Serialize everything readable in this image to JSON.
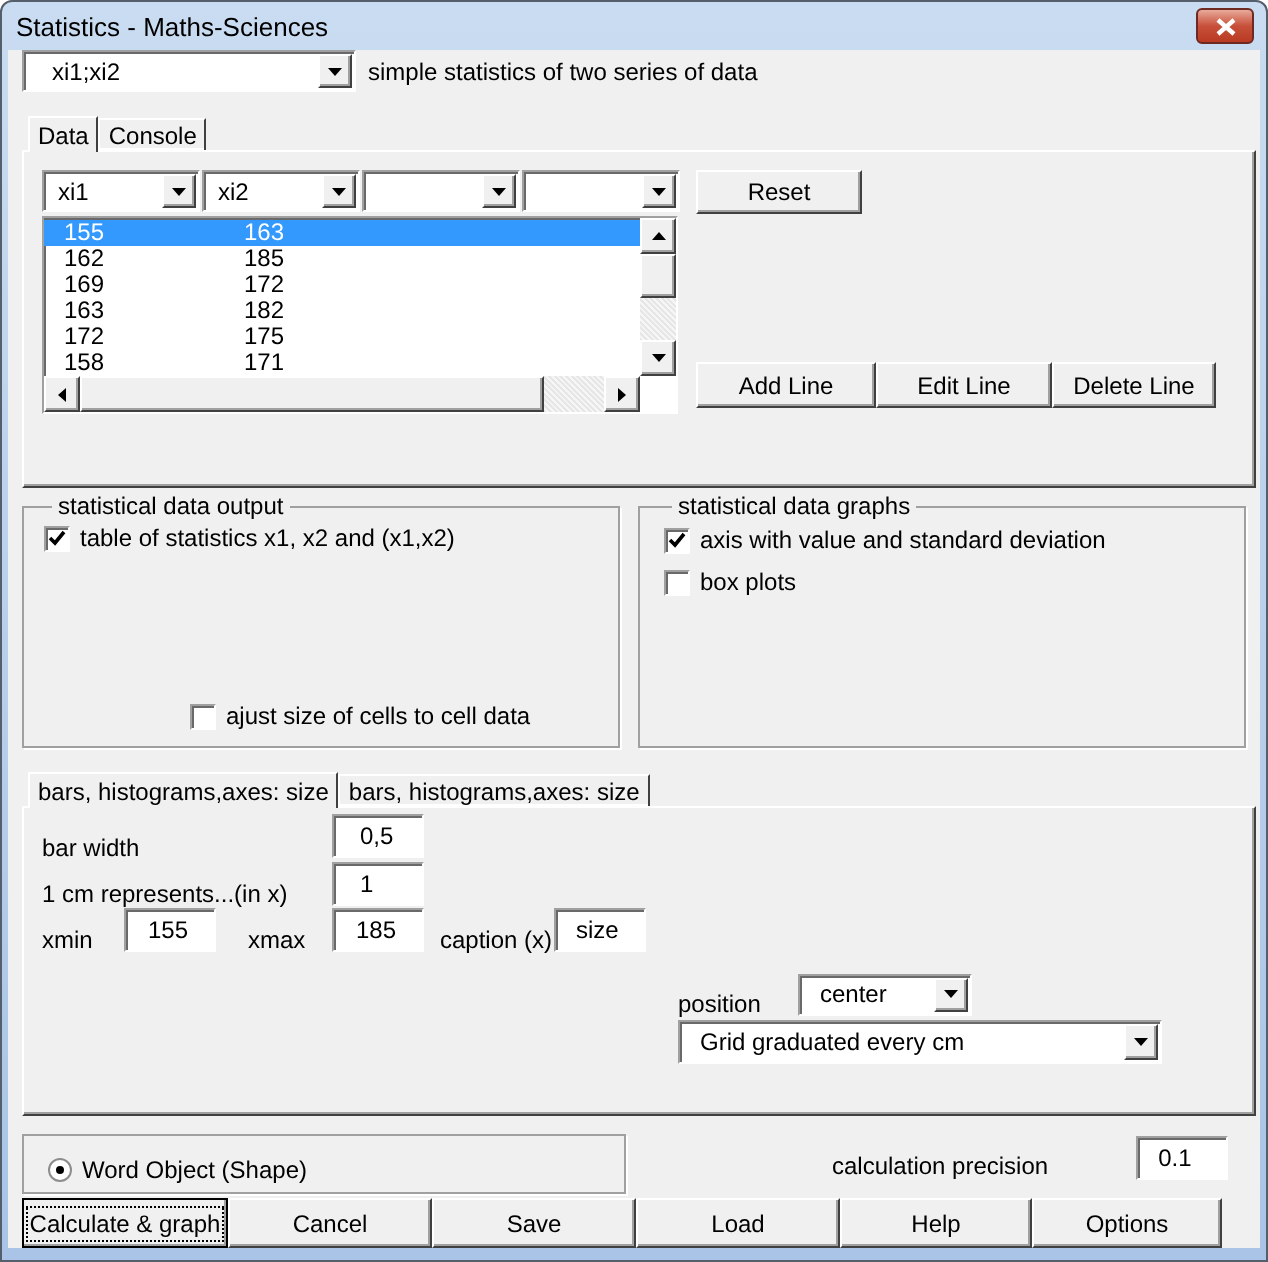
{
  "window": {
    "title": "Statistics - Maths-Sciences"
  },
  "series_select": {
    "value": "xi1;xi2"
  },
  "description": "simple statistics of two series of data",
  "tabs": [
    {
      "label": "Data",
      "selected": true
    },
    {
      "label": "Console",
      "selected": false
    }
  ],
  "column_selects": [
    {
      "kind": "filled",
      "value": "xi1"
    },
    {
      "kind": "filled",
      "value": "xi2"
    },
    {
      "kind": "blank"
    },
    {
      "kind": "blank"
    }
  ],
  "list": {
    "rows": [
      {
        "cells": [
          "155",
          "163"
        ],
        "selected": true
      },
      {
        "cells": [
          "162",
          "185"
        ],
        "selected": false
      },
      {
        "cells": [
          "169",
          "172"
        ],
        "selected": false
      },
      {
        "cells": [
          "163",
          "182"
        ],
        "selected": false
      },
      {
        "cells": [
          "172",
          "175"
        ],
        "selected": false
      },
      {
        "cells": [
          "158",
          "171"
        ],
        "selected": false
      }
    ]
  },
  "reset_button": "Reset",
  "line_buttons": [
    "Add Line",
    "Edit Line",
    "Delete Line"
  ],
  "output_group": {
    "title": "statistical data output",
    "options": [
      {
        "label": "table of statistics x1, x2 and (x1,x2)",
        "checked": true
      },
      {
        "label": "ajust size of cells to cell data",
        "checked": false
      }
    ]
  },
  "graphs_group": {
    "title": "statistical data graphs",
    "options": [
      {
        "label": "axis with value and standard deviation",
        "checked": true
      },
      {
        "label": "box plots",
        "checked": false
      }
    ]
  },
  "graph_tabs": [
    {
      "label": "bars, histograms,axes: size",
      "selected": true
    },
    {
      "label": "bars, histograms,axes: size",
      "selected": false
    }
  ],
  "bar_width": {
    "label": "bar width",
    "value": "0,5"
  },
  "cm_represents": {
    "label": "1 cm represents...(in x)",
    "value": "1"
  },
  "xmin": {
    "label": "xmin",
    "value": "155"
  },
  "xmax": {
    "label": "xmax",
    "value": "185"
  },
  "caption": {
    "label": "caption (x)",
    "value": "size"
  },
  "position": {
    "label": "position",
    "value": "center"
  },
  "grid_select": {
    "value": "Grid graduated every cm"
  },
  "output_choice": {
    "label": "Word Object (Shape)",
    "selected": true
  },
  "precision": {
    "label": "calculation precision",
    "value": "0.1"
  },
  "buttons": [
    {
      "label": "Calculate & graph",
      "default": true
    },
    {
      "label": "Cancel",
      "default": false
    },
    {
      "label": "Save",
      "default": false
    },
    {
      "label": "Load",
      "default": false
    },
    {
      "label": "Help",
      "default": false
    },
    {
      "label": "Options",
      "default": false
    }
  ]
}
